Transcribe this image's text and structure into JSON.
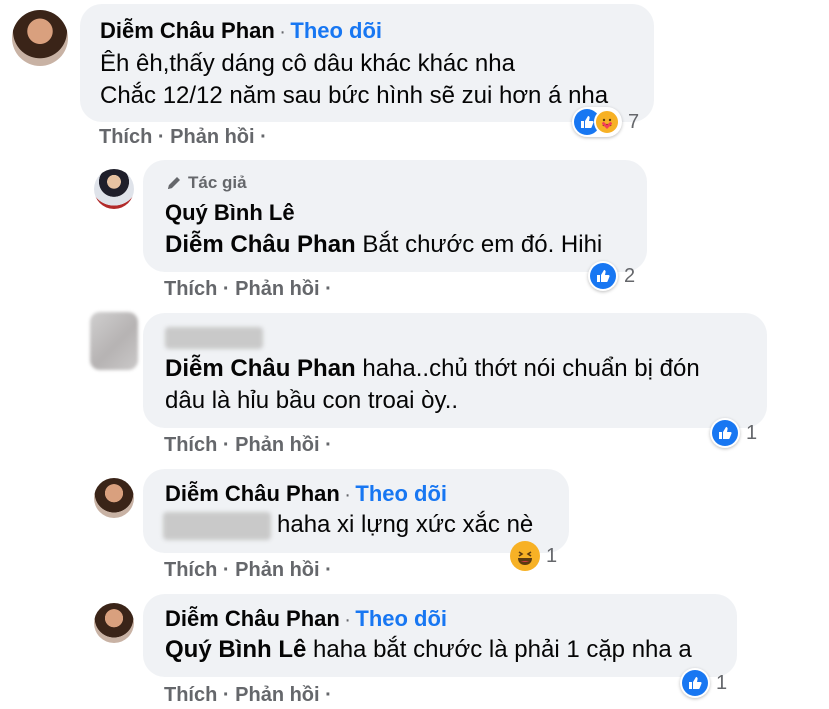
{
  "comments": [
    {
      "author": "Diễm Châu Phan",
      "separator": "·",
      "follow": "Theo dõi",
      "lines": [
        "Êh êh,thấy dáng cô dâu khác khác nha",
        "Chắc 12/12 năm sau bức hình sẽ zui hơn á nha"
      ],
      "actions": {
        "like": "Thích",
        "reply": "Phản hồi",
        "sep": "·"
      },
      "reactions": {
        "icons": [
          "like-icon",
          "care-icon"
        ],
        "count": "7"
      }
    },
    {
      "badge": "Tác giả",
      "author": "Quý Bình Lê",
      "mention": "Diễm Châu Phan",
      "text": " Bắt chước em đó. Hihi",
      "actions": {
        "like": "Thích",
        "reply": "Phản hồi",
        "sep": "·"
      },
      "reactions": {
        "icons": [
          "like-icon"
        ],
        "count": "2"
      }
    },
    {
      "author_blurred": true,
      "mention": "Diễm Châu Phan",
      "text": " haha..chủ thớt nói chuẩn bị đón",
      "text2": "dâu là hỉu bầu con troai òy..",
      "actions": {
        "like": "Thích",
        "reply": "Phản hồi",
        "sep": "·"
      },
      "reactions": {
        "icons": [
          "like-icon"
        ],
        "count": "1"
      }
    },
    {
      "author": "Diễm Châu Phan",
      "separator": "·",
      "follow": "Theo dõi",
      "mention_blurred": true,
      "text": "haha xi lựng xức xắc nè",
      "actions": {
        "like": "Thích",
        "reply": "Phản hồi",
        "sep": "·"
      },
      "reactions": {
        "icons": [
          "haha-icon"
        ],
        "count": "1"
      }
    },
    {
      "author": "Diễm Châu Phan",
      "separator": "·",
      "follow": "Theo dõi",
      "mention": "Quý Bình Lê",
      "text": " haha bắt chước là phải 1 cặp nha a",
      "actions": {
        "like": "Thích",
        "reply": "Phản hồi",
        "sep": "·"
      },
      "reactions": {
        "icons": [
          "like-icon"
        ],
        "count": "1"
      }
    }
  ],
  "colors": {
    "link": "#1877f2",
    "bubble": "#f0f2f5",
    "meta": "#65676b",
    "like": "#1877f2",
    "haha": "#f7b125"
  }
}
